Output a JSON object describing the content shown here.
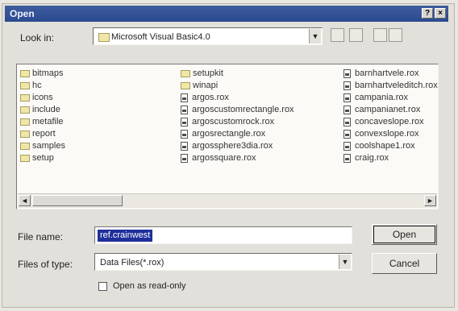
{
  "window": {
    "title": "Open",
    "help_glyph": "?",
    "close_glyph": "×"
  },
  "lookin": {
    "label": "Look in:",
    "value": "Microsoft Visual Basic4.0"
  },
  "files": {
    "col1": [
      {
        "name": "bitmaps",
        "type": "folder"
      },
      {
        "name": "hc",
        "type": "folder"
      },
      {
        "name": "icons",
        "type": "folder"
      },
      {
        "name": "include",
        "type": "folder"
      },
      {
        "name": "metafile",
        "type": "folder"
      },
      {
        "name": "report",
        "type": "folder"
      },
      {
        "name": "samples",
        "type": "folder"
      },
      {
        "name": "setup",
        "type": "folder"
      }
    ],
    "col2": [
      {
        "name": "setupkit",
        "type": "folder"
      },
      {
        "name": "winapi",
        "type": "folder"
      },
      {
        "name": "argos.rox",
        "type": "file"
      },
      {
        "name": "argoscustomrectangle.rox",
        "type": "file"
      },
      {
        "name": "argoscustomrock.rox",
        "type": "file"
      },
      {
        "name": "argosrectangle.rox",
        "type": "file"
      },
      {
        "name": "argossphere3dia.rox",
        "type": "file"
      },
      {
        "name": "argossquare.rox",
        "type": "file"
      }
    ],
    "col3": [
      {
        "name": "barnhartvele.rox",
        "type": "file"
      },
      {
        "name": "barnhartveleditch.rox",
        "type": "file"
      },
      {
        "name": "campania.rox",
        "type": "file"
      },
      {
        "name": "campanianet.rox",
        "type": "file"
      },
      {
        "name": "concaveslope.rox",
        "type": "file"
      },
      {
        "name": "convexslope.rox",
        "type": "file"
      },
      {
        "name": "coolshape1.rox",
        "type": "file"
      },
      {
        "name": "craig.rox",
        "type": "file"
      }
    ]
  },
  "filename": {
    "label": "File name:",
    "value": "ref.crainwest"
  },
  "filetype": {
    "label": "Files of type:",
    "value": "Data Files(*.rox)"
  },
  "buttons": {
    "open": "Open",
    "cancel": "Cancel"
  },
  "readonly": {
    "label": "Open as read-only",
    "checked": false
  }
}
